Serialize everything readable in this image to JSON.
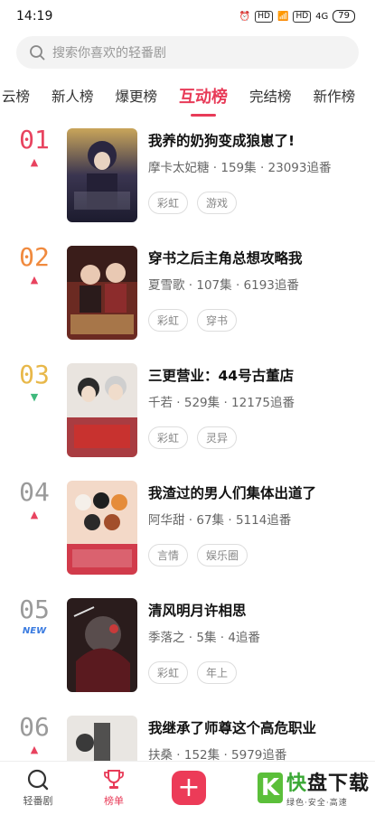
{
  "status": {
    "time": "14:19",
    "hd1": "HD",
    "hd2": "HD",
    "net": "4G",
    "battery": "79"
  },
  "search": {
    "placeholder": "搜索你喜欢的轻番剧"
  },
  "tabs": [
    "云榜",
    "新人榜",
    "爆更榜",
    "互动榜",
    "完结榜",
    "新作榜"
  ],
  "active_tab": "互动榜",
  "items": [
    {
      "rank": "01",
      "trend": "▲",
      "title": "我养的奶狗变成狼崽了!",
      "author": "摩卡太妃糖",
      "episodes": "159集",
      "follows": "23093追番",
      "tags": [
        "彩虹",
        "游戏"
      ]
    },
    {
      "rank": "02",
      "trend": "▲",
      "title": "穿书之后主角总想攻略我",
      "author": "夏雪歌",
      "episodes": "107集",
      "follows": "6193追番",
      "tags": [
        "彩虹",
        "穿书"
      ]
    },
    {
      "rank": "03",
      "trend": "▼",
      "title": "三更营业：44号古董店",
      "author": "千若",
      "episodes": "529集",
      "follows": "12175追番",
      "tags": [
        "彩虹",
        "灵异"
      ]
    },
    {
      "rank": "04",
      "trend": "▲",
      "title": "我渣过的男人们集体出道了",
      "author": "阿华甜",
      "episodes": "67集",
      "follows": "5114追番",
      "tags": [
        "言情",
        "娱乐圈"
      ]
    },
    {
      "rank": "05",
      "trend": "NEW",
      "title": "清风明月许相思",
      "author": "季落之",
      "episodes": "5集",
      "follows": "4追番",
      "tags": [
        "彩虹",
        "年上"
      ]
    },
    {
      "rank": "06",
      "trend": "▲",
      "title": "我继承了师尊这个高危职业",
      "author": "扶桑",
      "episodes": "152集",
      "follows": "5979追番",
      "tags": []
    }
  ],
  "nav": {
    "home": "轻番剧",
    "rank": "榜单"
  },
  "watermark": {
    "k": "K",
    "main1": "快",
    "main2": "盘下载",
    "sub": "绿色·安全·高速"
  },
  "colors": {
    "accent": "#e83b58",
    "rank1": "#e8435f",
    "rank2": "#f08a3e",
    "rank3": "#e8b84a",
    "up": "#e8435f",
    "down": "#3fb97c",
    "new": "#3a7be0"
  }
}
